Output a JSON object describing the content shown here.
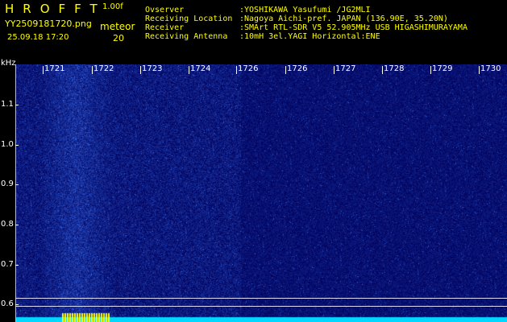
{
  "header": {
    "brand": "HROFFT",
    "version": "1.00f",
    "filename": "YY2509181720.png",
    "datetime": "25.09.18 17:20",
    "meteor_label": "meteor",
    "meteor_count": "20"
  },
  "info": [
    {
      "label": "Ovserver",
      "value": ":YOSHIKAWA Yasufumi /JG2MLI"
    },
    {
      "label": "Receiving Location",
      "value": ":Nagoya Aichi-pref. JAPAN (136.90E, 35.20N)"
    },
    {
      "label": "Receiver",
      "value": ":SMArt RTL-SDR V5 52.905MHz USB HIGASHIMURAYAMA"
    },
    {
      "label": "Receiving Antenna",
      "value": ":10mH 3el.YAGI Horizontal:ENE"
    }
  ],
  "chart_data": {
    "type": "heatmap",
    "x_tick_labels": [
      "1721",
      "1722",
      "1723",
      "1724",
      "1726",
      "1726",
      "1727",
      "1728",
      "1729",
      "1730"
    ],
    "y_unit": "kHz",
    "y_tick_labels": [
      "1.1",
      "1.0",
      "0.9",
      "0.8",
      "0.7",
      "0.6"
    ],
    "y_range": [
      0.58,
      1.18
    ],
    "colors": {
      "background": "#000000",
      "noise_low": "#00007a",
      "noise_high": "#2a5cff",
      "trace": "#00d8ff",
      "meteor": "#ffff00"
    }
  }
}
